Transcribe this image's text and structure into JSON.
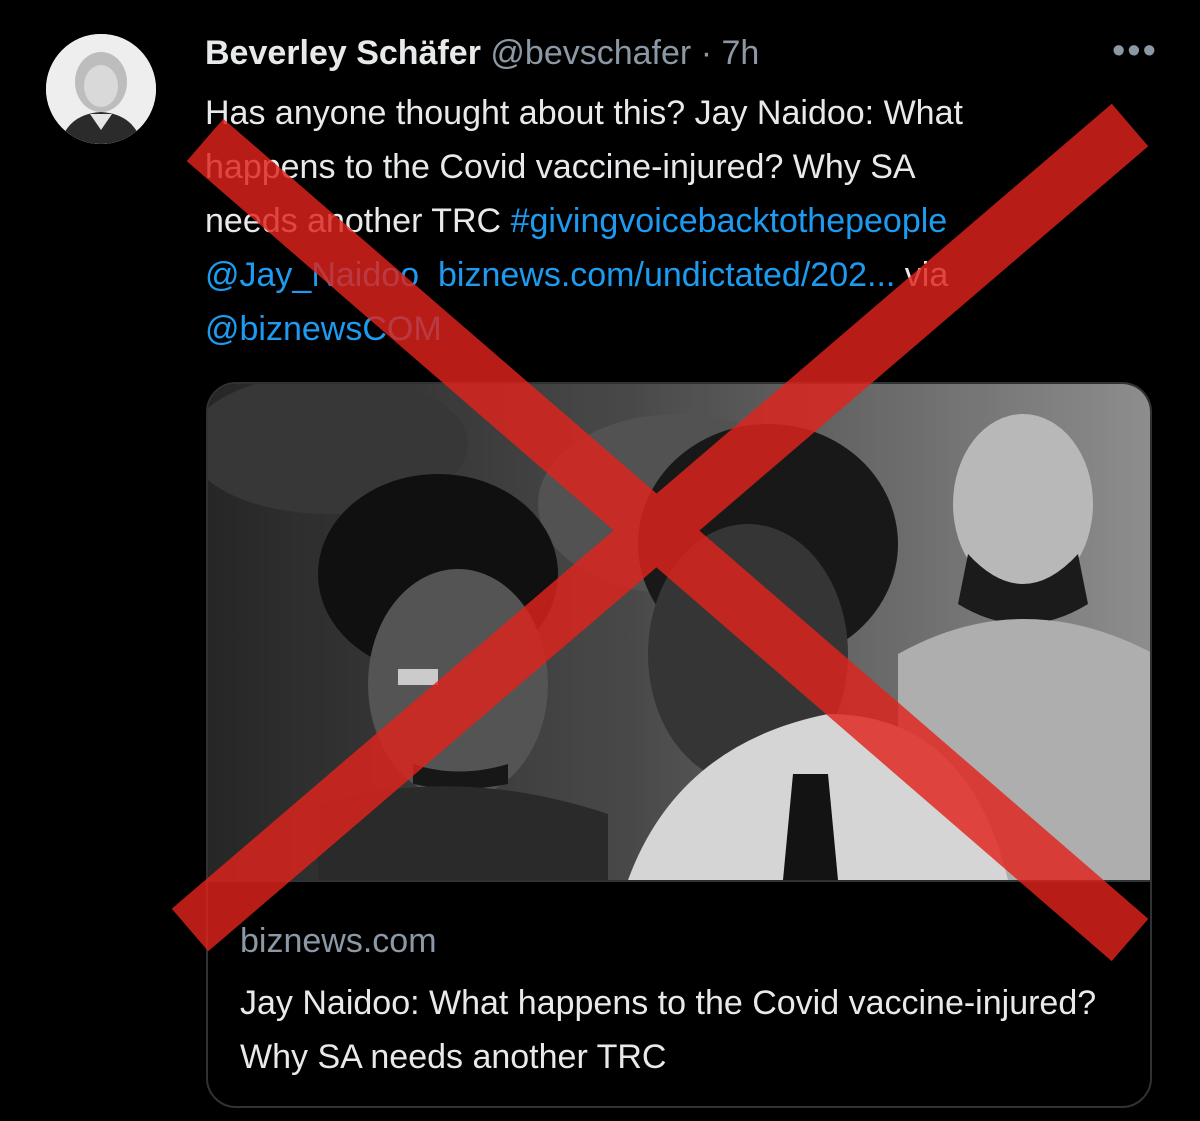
{
  "tweet": {
    "author_name": "Beverley Schäfer",
    "handle": "@bevschafer",
    "separator": "·",
    "time": "7h",
    "more_icon": "more-options-icon",
    "text_lines": [
      "Has anyone thought about this? Jay Naidoo: What",
      "happens to the Covid vaccine-injured? Why SA",
      "needs another TRC "
    ],
    "hashtag": "#givingvoicebacktothepeople",
    "mention_1": "@Jay_Naidoo",
    "url_text": "biznews.com/undictated/202...",
    "via": " via",
    "mention_2": "@biznewsCOM"
  },
  "card": {
    "domain": "biznews.com",
    "title": "Jay Naidoo: What happens to the Covid vaccine-injured? Why SA needs another TRC"
  },
  "overlay": {
    "icon": "red-x-cross-icon",
    "color": "#e0241c"
  },
  "colors": {
    "background": "#000000",
    "link": "#1d9bf0",
    "secondary_text": "#8b98a5",
    "border": "#2f3336"
  }
}
